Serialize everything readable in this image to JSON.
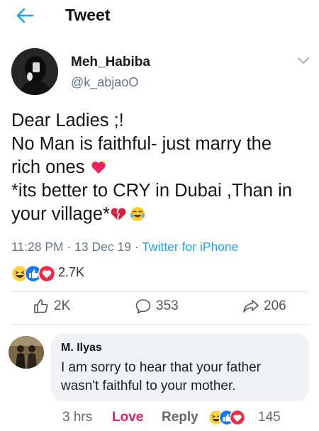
{
  "header": {
    "title": "Tweet",
    "back_icon": "back-arrow-icon",
    "accent": "#1da1f2"
  },
  "author": {
    "name": "Meh_Habiba",
    "handle": "@k_abjaoO"
  },
  "tweet": {
    "line1": "Dear Ladies ;!",
    "line2": "No Man is faithful- just marry the",
    "line3": "rich ones ",
    "line4": "*its better to CRY in Dubai ,Than in",
    "line5": "your village*",
    "emojis": [
      "sparkling-heart-icon",
      "broken-heart-icon",
      "tears-of-joy-icon"
    ]
  },
  "meta": {
    "time": "11:28 PM",
    "sep1": " · ",
    "date": "13 Dec 19",
    "sep2": " · ",
    "source": "Twitter for iPhone"
  },
  "reactions": {
    "count": "2.7K",
    "icons": [
      "haha-reaction-icon",
      "like-reaction-icon",
      "love-reaction-icon"
    ]
  },
  "actions": {
    "like_count": "2K",
    "comment_count": "353",
    "share_count": "206"
  },
  "comment": {
    "name": "M. Ilyas",
    "text": "I am sorry to hear that your father wasn't faithful to your mother.",
    "time": "3 hrs",
    "love_label": "Love",
    "reply_label": "Reply",
    "reaction_count": "145",
    "icons": [
      "haha-reaction-icon",
      "like-reaction-icon",
      "love-reaction-icon"
    ]
  },
  "colors": {
    "text_primary": "#14171a",
    "text_secondary": "#657786",
    "love": "#e0245e",
    "like_blue": "#1877f2"
  }
}
